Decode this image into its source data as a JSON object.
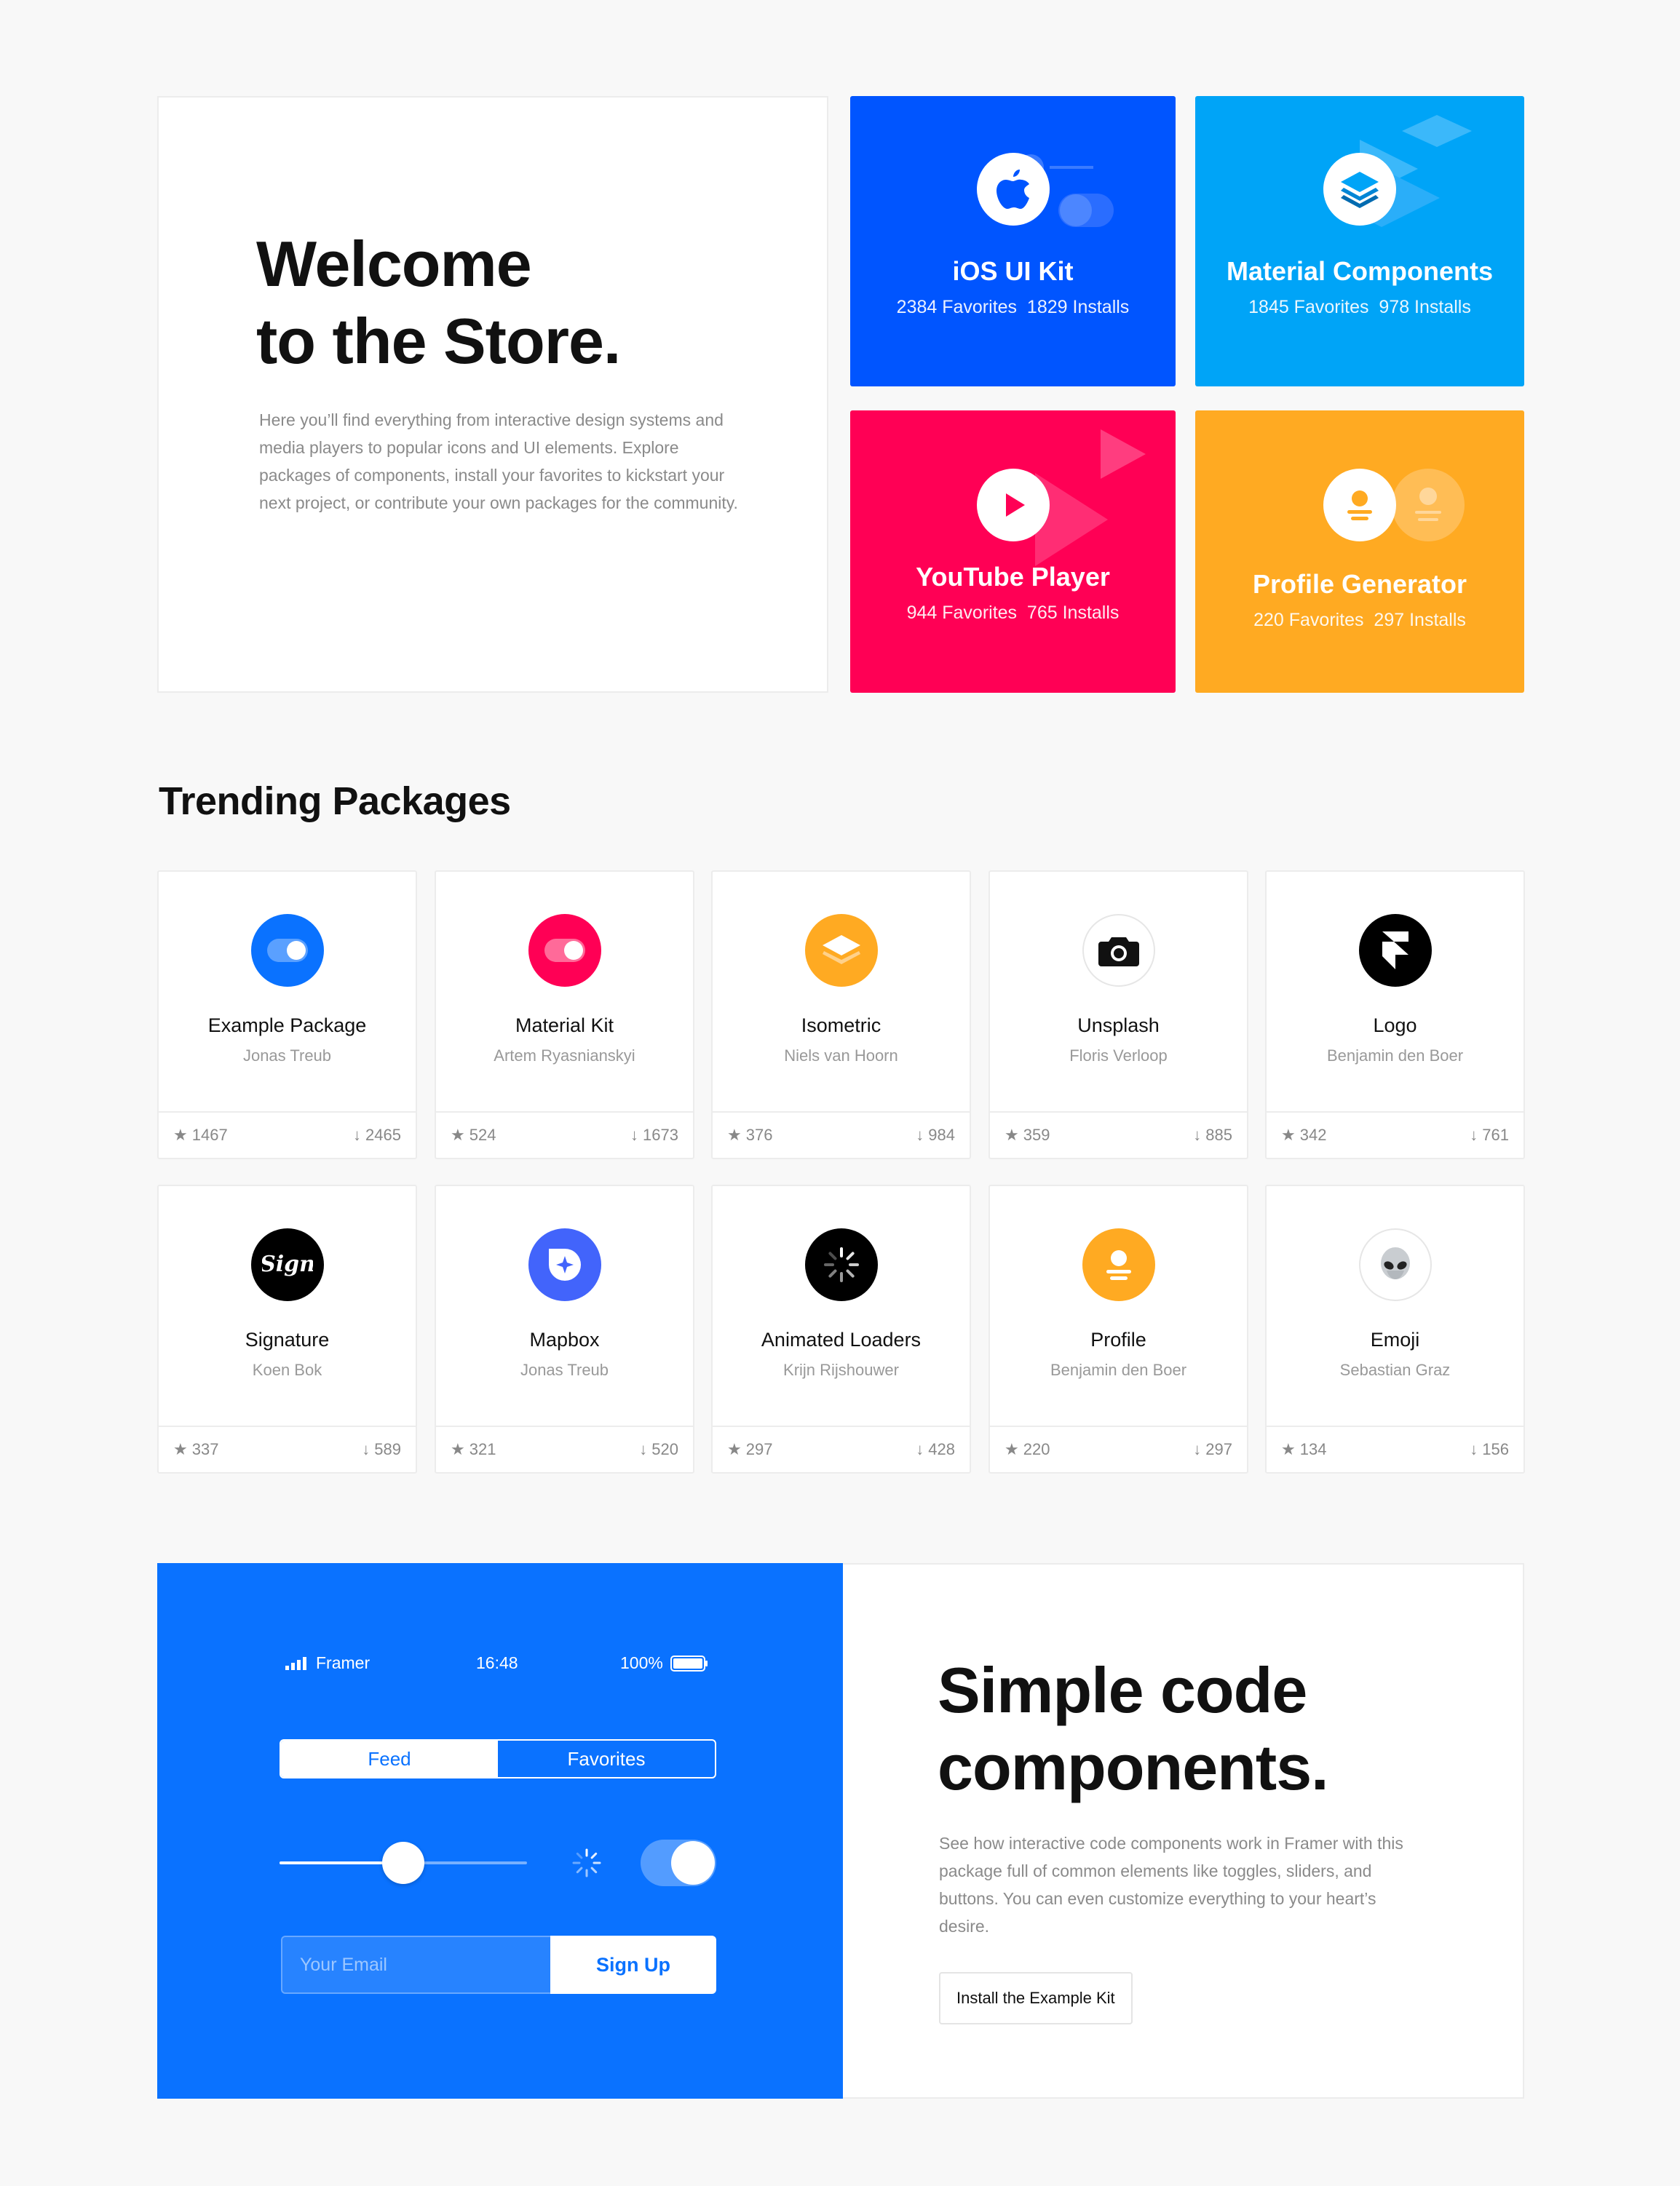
{
  "hero": {
    "title_line1": "Welcome",
    "title_line2": "to the Store.",
    "description": "Here you’ll find everything from interactive design systems and media players to popular icons and UI elements. Explore packages of components, install your favorites to kickstart your next project, or contribute your own packages for the community."
  },
  "featured": [
    {
      "title": "iOS UI Kit",
      "stats": "2384 Favorites  1829 Installs",
      "color": "#0055ff",
      "icon": "apple-icon"
    },
    {
      "title": "Material Components",
      "stats": "1845 Favorites  978 Installs",
      "color": "#00a4f7",
      "icon": "layers-icon"
    },
    {
      "title": "YouTube Player",
      "stats": "944 Favorites  765 Installs",
      "color": "#ff0055",
      "icon": "play-icon"
    },
    {
      "title": "Profile Generator",
      "stats": "220 Favorites  297 Installs",
      "color": "#ffaa22",
      "icon": "profile-icon"
    }
  ],
  "trending": {
    "title": "Trending Packages",
    "packages": [
      {
        "name": "Example Package",
        "author": "Jonas Treub",
        "favorites": "1467",
        "installs": "2465",
        "icon": "toggle-icon",
        "color": "#0a72ff"
      },
      {
        "name": "Material Kit",
        "author": "Artem Ryasnianskyi",
        "favorites": "524",
        "installs": "1673",
        "icon": "toggle-icon",
        "color": "#ff0055"
      },
      {
        "name": "Isometric",
        "author": "Niels van Hoorn",
        "favorites": "376",
        "installs": "984",
        "icon": "isometric-icon",
        "color": "#ffaa22"
      },
      {
        "name": "Unsplash",
        "author": "Floris Verloop",
        "favorites": "359",
        "installs": "885",
        "icon": "camera-icon",
        "color": "#ffffff"
      },
      {
        "name": "Logo",
        "author": "Benjamin den Boer",
        "favorites": "342",
        "installs": "761",
        "icon": "framer-logo-icon",
        "color": "#000000"
      },
      {
        "name": "Signature",
        "author": "Koen Bok",
        "favorites": "337",
        "installs": "589",
        "icon": "signature-icon",
        "color": "#000000"
      },
      {
        "name": "Mapbox",
        "author": "Jonas Treub",
        "favorites": "321",
        "installs": "520",
        "icon": "mapbox-icon",
        "color": "#4264fb"
      },
      {
        "name": "Animated Loaders",
        "author": "Krijn Rijshouwer",
        "favorites": "297",
        "installs": "428",
        "icon": "loader-icon",
        "color": "#000000"
      },
      {
        "name": "Profile",
        "author": "Benjamin den Boer",
        "favorites": "220",
        "installs": "297",
        "icon": "profile-icon",
        "color": "#ffaa22"
      },
      {
        "name": "Emoji",
        "author": "Sebastian Graz",
        "favorites": "134",
        "installs": "156",
        "icon": "alien-icon",
        "color": "#ffffff"
      }
    ]
  },
  "demo": {
    "carrier": "Framer",
    "time": "16:48",
    "battery": "100%",
    "seg_feed": "Feed",
    "seg_favorites": "Favorites",
    "slider_value": 0.5,
    "email_placeholder": "Your Email",
    "signup_label": "Sign Up",
    "accent": "#0a72ff"
  },
  "simple": {
    "title_line1": "Simple code",
    "title_line2": "components.",
    "description": "See how interactive code components work in Framer with this package full of common elements like toggles, sliders, and buttons. You can even customize everything to your heart’s desire.",
    "button_label": "Install the Example Kit"
  }
}
